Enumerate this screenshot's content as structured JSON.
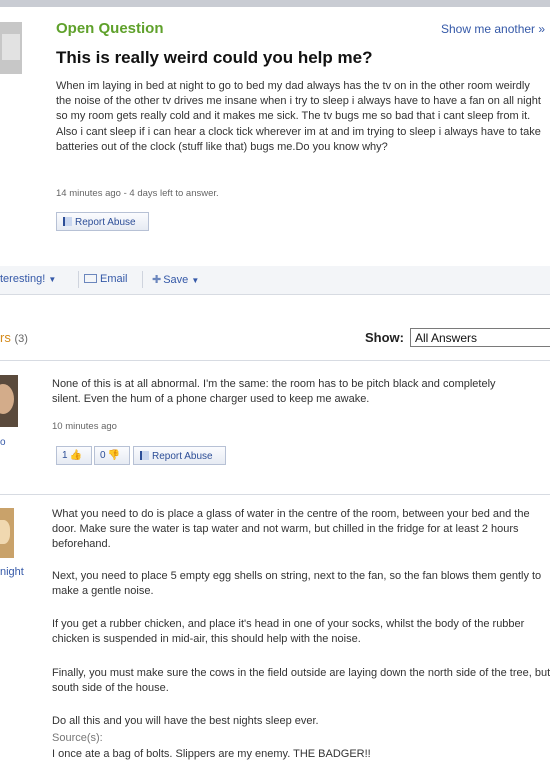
{
  "question": {
    "status_label": "Open Question",
    "show_another": "Show me another »",
    "title": "This is really weird could you help me?",
    "body": "When im laying in bed at night to go to bed my dad always has the tv on in the other room weirdly the noise of the other tv drives me insane when i try to sleep i always have to have a fan on all night so my room gets really cold and it makes me sick. The tv bugs me so bad that i cant sleep from it. Also i cant sleep if i can hear a clock tick wherever im at and im trying to sleep i always have to take batteries out of the clock (stuff like that) bugs me.Do you know why?",
    "meta": "14 minutes ago - 4 days left to answer.",
    "report_abuse": "Report Abuse"
  },
  "actions": {
    "interesting": "teresting!",
    "email": "Email",
    "save": "Save"
  },
  "answers_header": {
    "label": "rs",
    "count": "(3)",
    "show_label": "Show:",
    "show_value": "All Answers"
  },
  "answers": [
    {
      "user_fragment": "o",
      "text": "None of this is at all abnormal. I'm the same: the room has to be pitch black and completely silent. Even the hum of a phone charger used to keep me awake.",
      "meta": "10 minutes ago",
      "thumbs_up": "1",
      "thumbs_down": "0",
      "report_abuse": "Report Abuse"
    },
    {
      "user_fragment": "night",
      "paragraphs": [
        "What you need to do is place a glass of water in the centre of the room, between your bed and the door. Make sure the water is tap water and not warm, but chilled in the fridge for at least 2 hours beforehand.",
        "Next, you need to place 5 empty egg shells on string, next to the fan, so the fan blows them gently to make a gentle noise.",
        "If you get a rubber chicken, and place it's head in one of your socks, whilst the body of the rubber chicken is suspended in mid-air, this should help with the noise.",
        "Finally, you must make sure the cows in the field outside are laying down the north side of the tree, but south side of the house.",
        "Do all this and you will have the best nights sleep ever."
      ],
      "source_label": "Source(s):",
      "source_text": "I once ate a bag of bolts. Slippers are my enemy. THE BADGER!!"
    }
  ]
}
